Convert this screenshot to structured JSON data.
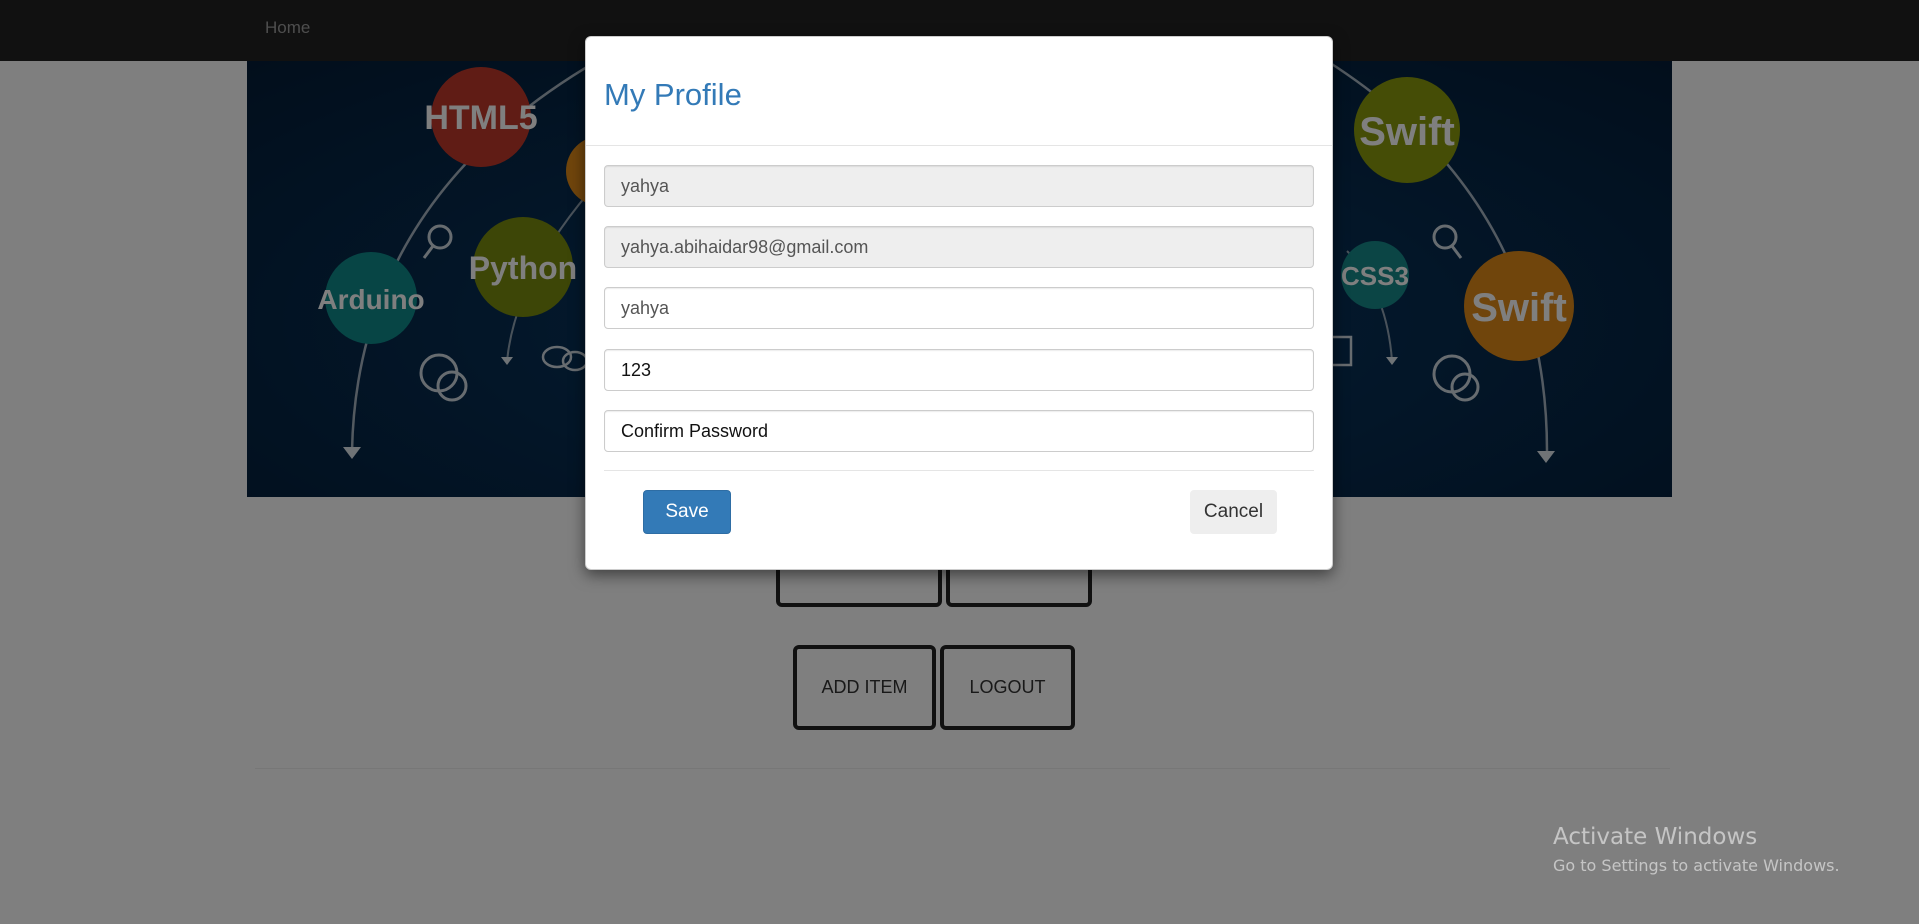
{
  "navbar": {
    "home_label": "Home"
  },
  "banner": {
    "bubbles": [
      {
        "label": "HTML5",
        "color": "#c0392b"
      },
      {
        "label": "Python",
        "color": "#7a8c0e"
      },
      {
        "label": "Arduino",
        "color": "#0e8a8a"
      },
      {
        "label": "Swift",
        "color": "#8a9a0c"
      },
      {
        "label": "CSS3",
        "color": "#168a8a"
      },
      {
        "label": "Swift",
        "color": "#e08a18"
      }
    ]
  },
  "page": {
    "buttons": [
      "ADD ITEM",
      "LOGOUT"
    ]
  },
  "watermark": {
    "title": "Activate Windows",
    "subtitle": "Go to Settings to activate Windows."
  },
  "modal": {
    "title": "My Profile",
    "fields": {
      "username": {
        "value": "yahya"
      },
      "email": {
        "value": "yahya.abihaidar98@gmail.com"
      },
      "name": {
        "value": "yahya"
      },
      "password": {
        "value": "123"
      },
      "confirm": {
        "placeholder": "Confirm Password"
      }
    },
    "save_label": "Save",
    "cancel_label": "Cancel"
  }
}
